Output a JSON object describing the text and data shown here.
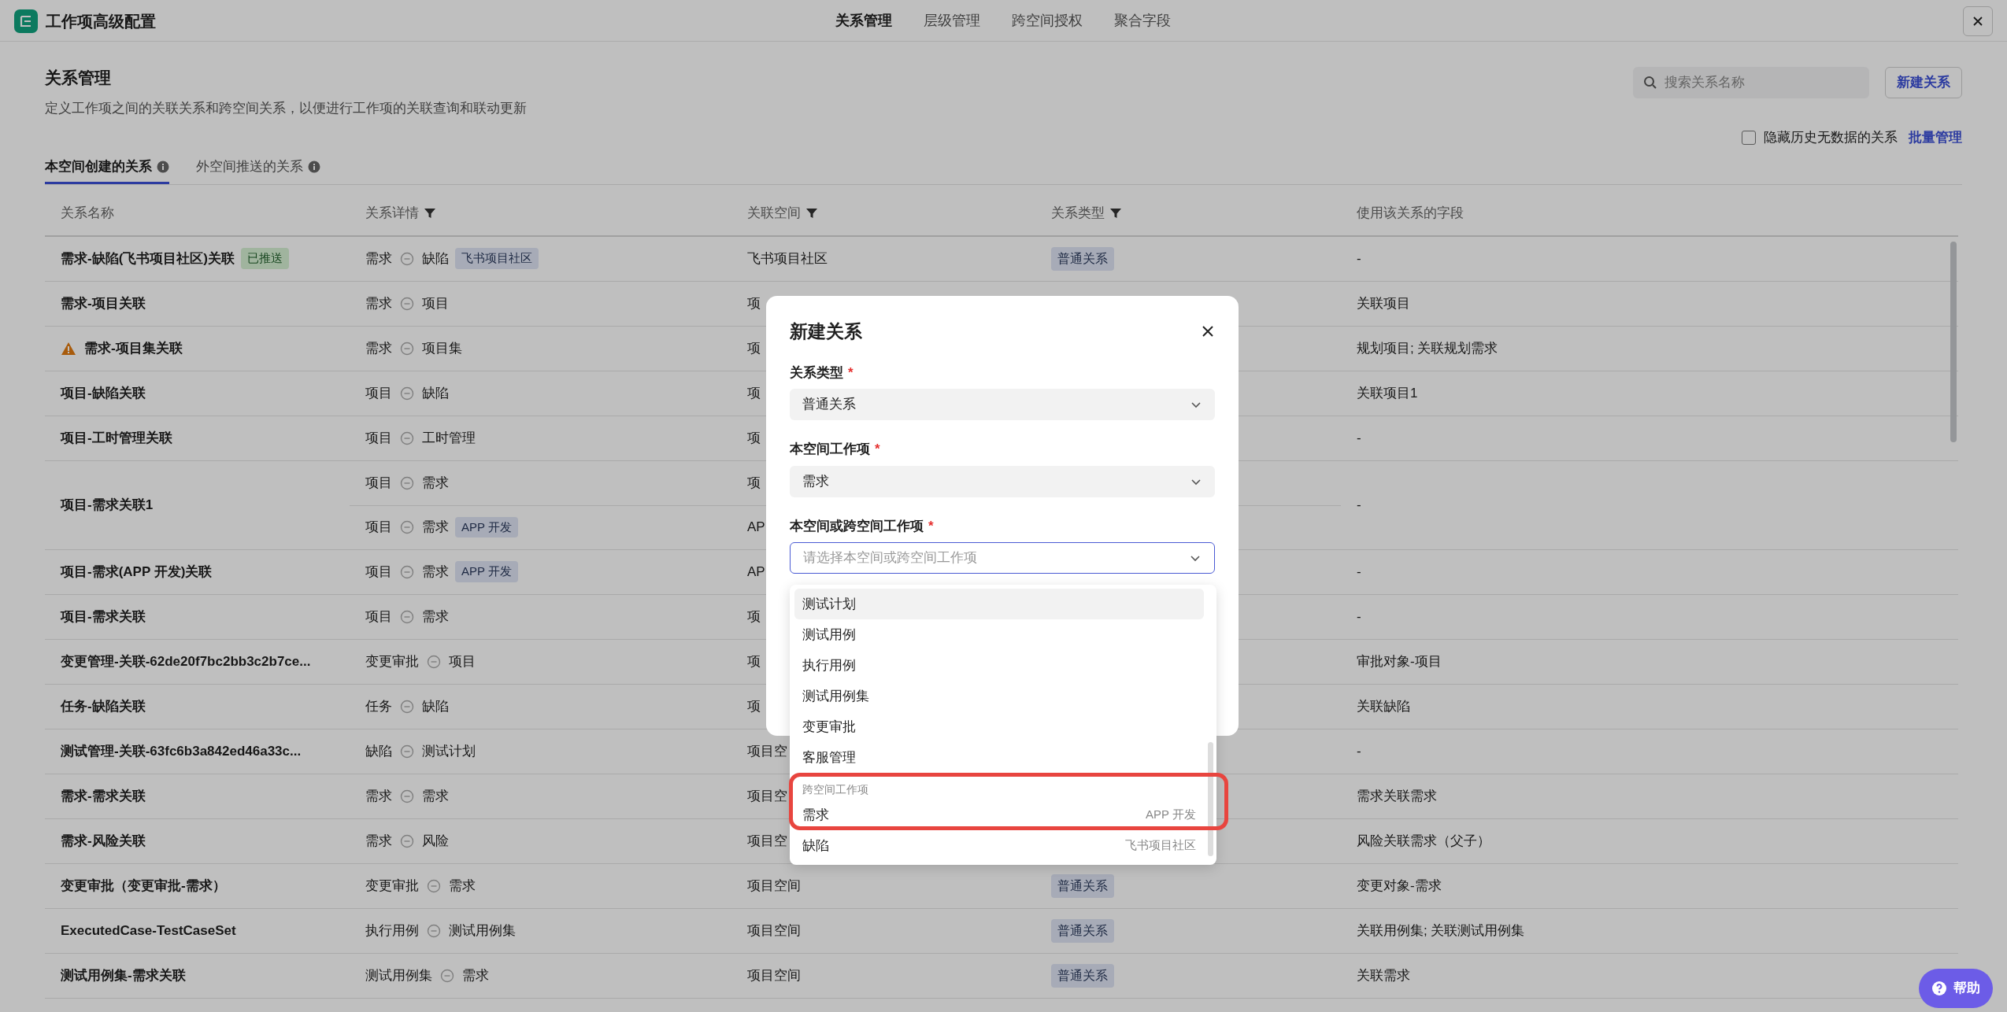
{
  "header": {
    "title": "工作项高级配置",
    "tabs": [
      {
        "label": "关系管理",
        "selected": true
      },
      {
        "label": "层级管理",
        "selected": false
      },
      {
        "label": "跨空间授权",
        "selected": false
      },
      {
        "label": "聚合字段",
        "selected": false
      }
    ]
  },
  "page": {
    "title": "关系管理",
    "description": "定义工作项之间的关联关系和跨空间关系，以便进行工作项的关联查询和联动更新",
    "search": {
      "placeholder": "搜索关系名称"
    },
    "new_button": "新建关系",
    "hide_empty": {
      "label": "隐藏历史无数据的关系",
      "checked": false
    },
    "batch_link": "批量管理"
  },
  "subtabs": [
    {
      "label": "本空间创建的关系",
      "selected": true
    },
    {
      "label": "外空间推送的关系",
      "selected": false
    }
  ],
  "table": {
    "columns": [
      {
        "label": "关系名称",
        "filter": false
      },
      {
        "label": "关系详情",
        "filter": true
      },
      {
        "label": "关联空间",
        "filter": true
      },
      {
        "label": "关系类型",
        "filter": true
      },
      {
        "label": "使用该关系的字段",
        "filter": false
      }
    ],
    "rows": [
      {
        "name": "需求-缺陷(飞书项目社区)关联",
        "warning": false,
        "badge": "已推送",
        "lines": [
          {
            "from": "需求",
            "to": "缺陷",
            "space_tag": "飞书项目社区",
            "space": "飞书项目社区",
            "type": "普通关系"
          }
        ],
        "fields": "-"
      },
      {
        "name": "需求-项目关联",
        "warning": false,
        "lines": [
          {
            "from": "需求",
            "to": "项目",
            "space": "项"
          }
        ],
        "fields": "关联项目"
      },
      {
        "name": "需求-项目集关联",
        "warning": true,
        "lines": [
          {
            "from": "需求",
            "to": "项目集",
            "space": "项"
          }
        ],
        "fields": "规划项目; 关联规划需求"
      },
      {
        "name": "项目-缺陷关联",
        "warning": false,
        "lines": [
          {
            "from": "项目",
            "to": "缺陷",
            "space": "项"
          }
        ],
        "fields": "关联项目1"
      },
      {
        "name": "项目-工时管理关联",
        "warning": false,
        "lines": [
          {
            "from": "项目",
            "to": "工时管理",
            "space": "项"
          }
        ],
        "fields": "-"
      },
      {
        "name": "项目-需求关联1",
        "warning": false,
        "lines": [
          {
            "from": "项目",
            "to": "需求",
            "space": "项"
          },
          {
            "from": "项目",
            "to": "需求",
            "space_tag": "APP 开发",
            "space": "AP"
          }
        ],
        "fields": "-"
      },
      {
        "name": "项目-需求(APP 开发)关联",
        "warning": false,
        "lines": [
          {
            "from": "项目",
            "to": "需求",
            "space_tag": "APP 开发",
            "space": "AP"
          }
        ],
        "fields": "-"
      },
      {
        "name": "项目-需求关联",
        "warning": false,
        "lines": [
          {
            "from": "项目",
            "to": "需求",
            "space": "项"
          }
        ],
        "fields": "-"
      },
      {
        "name": "变更管理-关联-62de20f7bc2bb3c2b7ce...",
        "warning": false,
        "lines": [
          {
            "from": "变更审批",
            "to": "项目",
            "space": "项"
          }
        ],
        "fields": "审批对象-项目"
      },
      {
        "name": "任务-缺陷关联",
        "warning": false,
        "lines": [
          {
            "from": "任务",
            "to": "缺陷",
            "space": "项"
          }
        ],
        "fields": "关联缺陷"
      },
      {
        "name": "测试管理-关联-63fc6b3a842ed46a33c...",
        "warning": false,
        "lines": [
          {
            "from": "缺陷",
            "to": "测试计划",
            "space": "项目空"
          }
        ],
        "fields": "-"
      },
      {
        "name": "需求-需求关联",
        "warning": false,
        "lines": [
          {
            "from": "需求",
            "to": "需求",
            "space": "项目空"
          }
        ],
        "fields": "需求关联需求"
      },
      {
        "name": "需求-风险关联",
        "warning": false,
        "lines": [
          {
            "from": "需求",
            "to": "风险",
            "space": "项目空"
          }
        ],
        "fields": "风险关联需求（父子）"
      },
      {
        "name": "变更审批（变更审批-需求）",
        "warning": false,
        "lines": [
          {
            "from": "变更审批",
            "to": "需求",
            "space": "项目空间",
            "type": "普通关系"
          }
        ],
        "fields": "变更对象-需求"
      },
      {
        "name": "ExecutedCase-TestCaseSet",
        "warning": false,
        "lines": [
          {
            "from": "执行用例",
            "to": "测试用例集",
            "space": "项目空间",
            "type": "普通关系"
          }
        ],
        "fields": "关联用例集; 关联测试用例集"
      },
      {
        "name": "测试用例集-需求关联",
        "warning": false,
        "lines": [
          {
            "from": "测试用例集",
            "to": "需求",
            "space": "项目空间",
            "type": "普通关系"
          }
        ],
        "fields": "关联需求"
      }
    ]
  },
  "dialog": {
    "title": "新建关系",
    "fields": [
      {
        "label": "关系类型",
        "required": "*",
        "value": "普通关系",
        "focused": false
      },
      {
        "label": "本空间工作项",
        "required": "*",
        "value": "需求",
        "focused": false
      },
      {
        "label": "本空间或跨空间工作项",
        "required": "*",
        "placeholder": "请选择本空间或跨空间工作项",
        "focused": true
      }
    ],
    "dropdown": [
      {
        "kind": "option",
        "label": "测试计划",
        "highlighted": true
      },
      {
        "kind": "option",
        "label": "测试用例",
        "highlighted": false
      },
      {
        "kind": "option",
        "label": "执行用例",
        "highlighted": false
      },
      {
        "kind": "option",
        "label": "测试用例集",
        "highlighted": false
      },
      {
        "kind": "option",
        "label": "变更审批",
        "highlighted": false
      },
      {
        "kind": "option",
        "label": "客服管理",
        "highlighted": false
      },
      {
        "kind": "group",
        "label": "跨空间工作项"
      },
      {
        "kind": "option",
        "label": "需求",
        "space_tag": "APP 开发",
        "highlighted": false
      },
      {
        "kind": "option",
        "label": "缺陷",
        "space_tag": "飞书项目社区",
        "highlighted": false
      }
    ]
  },
  "help_button": "帮助"
}
